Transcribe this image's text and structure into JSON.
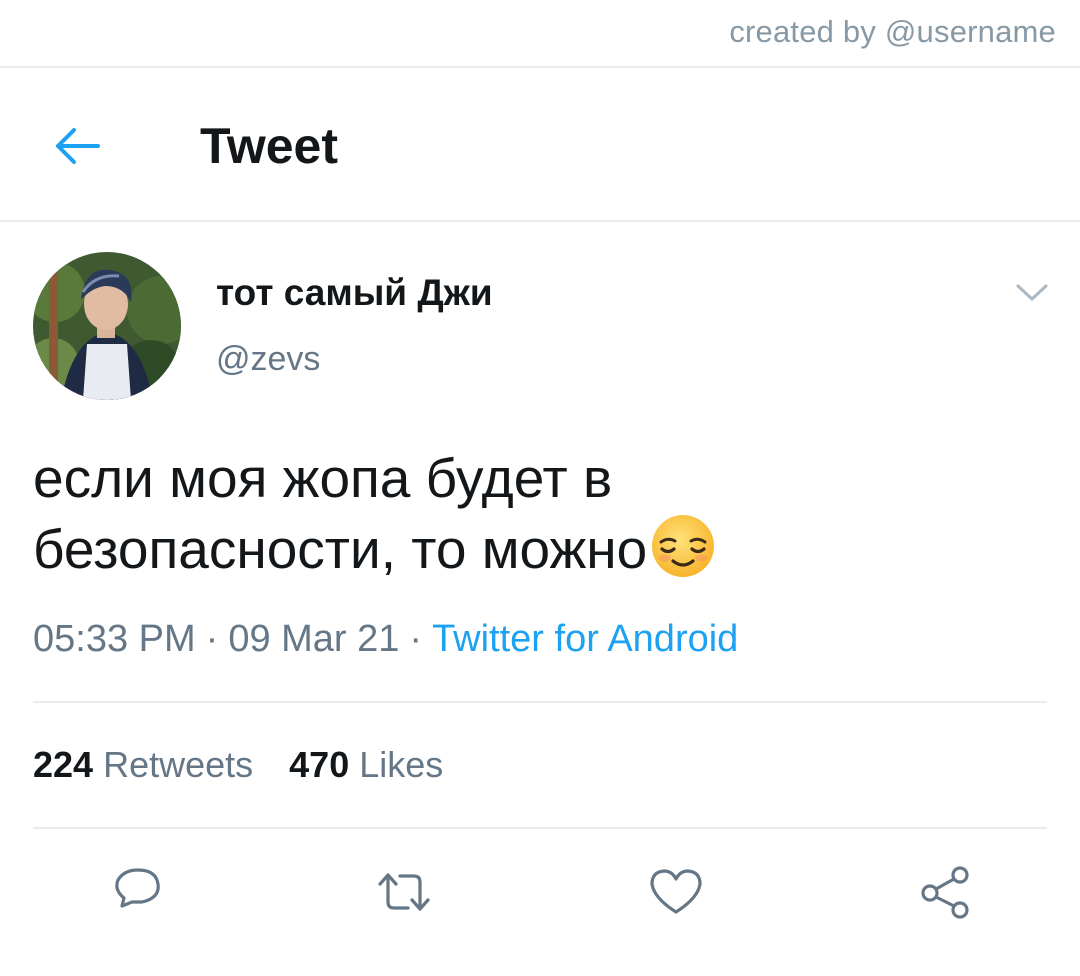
{
  "credit": "created by @username",
  "header": {
    "title": "Tweet",
    "back_icon": "arrow-left-icon"
  },
  "author": {
    "display_name": "тот самый Джи",
    "handle": "@zevs",
    "avatar": "profile-photo"
  },
  "tweet": {
    "text_line1": "если моя жопа будет в",
    "text_line2": "безопасности, то можно",
    "emoji": "relieved-face-emoji",
    "time": "05:33 PM",
    "date": "09 Mar 21",
    "separator": "·",
    "source": "Twitter for Android"
  },
  "stats": {
    "retweets_count": "224",
    "retweets_label": "Retweets",
    "likes_count": "470",
    "likes_label": "Likes"
  },
  "actions": {
    "reply": "reply-icon",
    "retweet": "retweet-icon",
    "like": "heart-icon",
    "share": "share-icon"
  },
  "colors": {
    "accent": "#1da1f2",
    "text": "#14171a",
    "secondary": "#657786",
    "divider": "#e6ecf0"
  }
}
